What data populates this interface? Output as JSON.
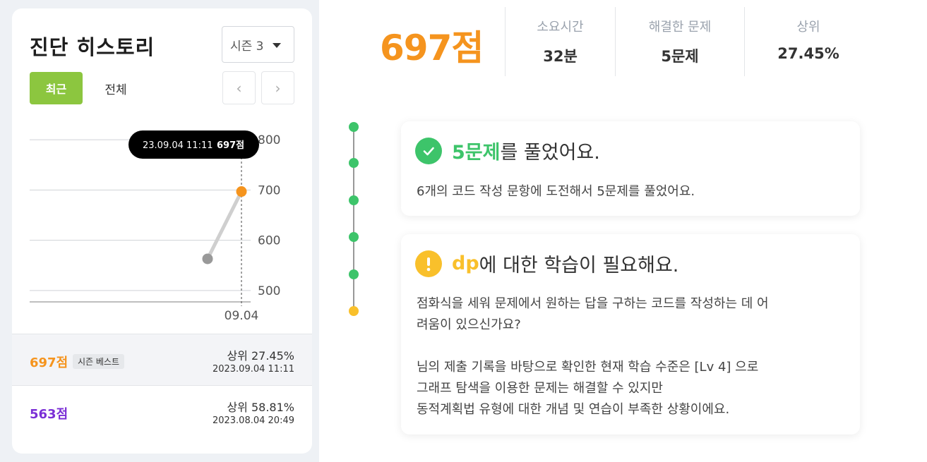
{
  "history": {
    "title": "진단 히스토리",
    "season_label": "시즌 3",
    "tabs": {
      "recent": "최근",
      "all": "전체"
    },
    "prev_label": "‹",
    "next_label": "›"
  },
  "chart_data": {
    "type": "line",
    "ylim": [
      490,
      810
    ],
    "y_ticks": [
      500,
      600,
      700,
      800
    ],
    "x_tick_label": "09.04",
    "points": [
      {
        "x": "23.08.04 20:49",
        "y": 563,
        "color": "#999999"
      },
      {
        "x": "23.09.04 11:11",
        "y": 697,
        "color": "#f5941e"
      }
    ],
    "tooltip": {
      "date": "23.09.04 11:11",
      "score": "697점"
    }
  },
  "records": [
    {
      "score": "697점",
      "badge": "시즌 베스트",
      "rank": "상위 27.45%",
      "date": "2023.09.04 11:11",
      "color": "#f5941e"
    },
    {
      "score": "563점",
      "badge": "",
      "rank": "상위 58.81%",
      "date": "2023.08.04 20:49",
      "color": "#7b2fd6"
    }
  ],
  "summary": {
    "score": "697점",
    "stats": [
      {
        "label": "소요시간",
        "value": "32분"
      },
      {
        "label": "해결한 문제",
        "value": "5문제"
      },
      {
        "label": "상위",
        "value": "27.45%"
      }
    ]
  },
  "feedback": {
    "solved": {
      "highlight": "5문제",
      "title_rest": "를 풀었어요.",
      "body": "6개의 코드 작성 문항에 도전해서 5문제를 풀었어요."
    },
    "study": {
      "highlight": "dp",
      "title_rest": "에 대한 학습이 필요해요.",
      "body1": "점화식을 세워 문제에서 원하는 답을 구하는 코드를 작성하는 데 어",
      "body2": "려움이 있으신가요?",
      "body3": "님의 제출 기록을 바탕으로 확인한 현재 학습 수준은 [Lv 4] 으로",
      "body4": "그래프 탐색을 이용한 문제는 해결할 수 있지만",
      "body5": "동적계획법 유형에 대한 개념 및 연습이 부족한 상황이에요."
    }
  },
  "colors": {
    "accent": "#f5941e",
    "green": "#3dc46a",
    "yellow": "#f9c02b",
    "tab_active": "#8cc63f"
  }
}
